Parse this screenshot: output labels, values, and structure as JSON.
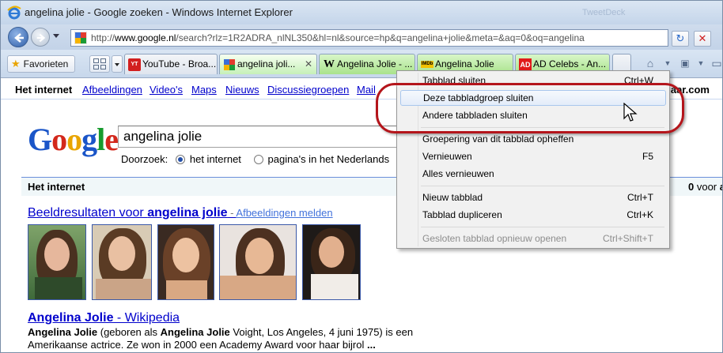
{
  "window": {
    "title": "angelina jolie - Google zoeken - Windows Internet Explorer",
    "faint_background_text": "TweetDeck"
  },
  "address_bar": {
    "url_prefix": "http://",
    "url_host": "www.google.nl",
    "url_rest": "/search?rlz=1R2ADRA_nlNL350&hl=nl&source=hp&q=angelina+jolie&meta=&aq=0&oq=angelina"
  },
  "toolbar": {
    "favorites_label": "Favorieten",
    "new_tab_icon": "new-tab-icon",
    "home_icon": "home-icon",
    "feeds_icon": "rss-icon"
  },
  "tabs": [
    {
      "label": "YouTube - Broa...",
      "icon": "YouTube",
      "color": "#dfe5ee"
    },
    {
      "label": "angelina joli...",
      "icon": "google",
      "color": "#c6f0b8",
      "close": "✕"
    },
    {
      "label": "Angelina Jolie - ...",
      "icon": "W",
      "color": "#a9e28c"
    },
    {
      "label": "Angelina Jolie",
      "icon": "IMDb",
      "color": "#a9e28c"
    },
    {
      "label": "AD Celebs - An...",
      "icon": "AD",
      "color": "#a9e28c"
    }
  ],
  "google_nav": {
    "items": [
      "Het internet",
      "Afbeeldingen",
      "Video's",
      "Maps",
      "Nieuws",
      "Discussiegroepen",
      "Mail"
    ],
    "right_text": "aar.com"
  },
  "search": {
    "logo": [
      "G",
      "o",
      "o",
      "g",
      "l",
      "e"
    ],
    "query": "angelina jolie",
    "scope_label": "Doorzoek:",
    "scope_options": [
      "het internet",
      "pagina's in het Nederlands"
    ]
  },
  "results_bar": {
    "label": "Het internet",
    "count_prefix": "0",
    "count_text": " voor ",
    "count_query": "an"
  },
  "image_results": {
    "title_prefix": "Beeldresultaten voor ",
    "title_query": "angelina jolie",
    "separator": " - ",
    "report_link": "Afbeeldingen melden"
  },
  "wiki_result": {
    "title": "Angelina Jolie",
    "suffix": " - Wikipedia",
    "snippet_line1_bold1": "Angelina Jolie",
    "snippet_line1_mid": " (geboren als ",
    "snippet_line1_bold2": "Angelina Jolie",
    "snippet_line1_end": " Voight, Los Angeles, 4 juni 1975) is een",
    "snippet_line2": "Amerikaanse actrice. Ze won in 2000 een Academy Award voor haar bijrol ",
    "snippet_line2_end": "..."
  },
  "context_menu": {
    "items": [
      {
        "label": "Tabblad sluiten",
        "shortcut": "Ctrl+W",
        "state": "normal"
      },
      {
        "label": "Deze tabbladgroep sluiten",
        "shortcut": "",
        "state": "hover"
      },
      {
        "label": "Andere tabbladen sluiten",
        "shortcut": "",
        "state": "normal"
      },
      {
        "label": "Groepering van dit tabblad opheffen",
        "shortcut": "",
        "state": "normal"
      },
      {
        "label": "Vernieuwen",
        "shortcut": "F5",
        "state": "normal"
      },
      {
        "label": "Alles vernieuwen",
        "shortcut": "",
        "state": "normal"
      },
      {
        "label": "Nieuw tabblad",
        "shortcut": "Ctrl+T",
        "state": "normal"
      },
      {
        "label": "Tabblad dupliceren",
        "shortcut": "Ctrl+K",
        "state": "normal"
      },
      {
        "label": "Gesloten tabblad opnieuw openen",
        "shortcut": "Ctrl+Shift+T",
        "state": "disabled"
      }
    ]
  },
  "colors": {
    "highlight_ring": "#b4151b",
    "link": "#0000cc",
    "google_tab": "#c6f0b8",
    "group_tab": "#a9e28c"
  }
}
